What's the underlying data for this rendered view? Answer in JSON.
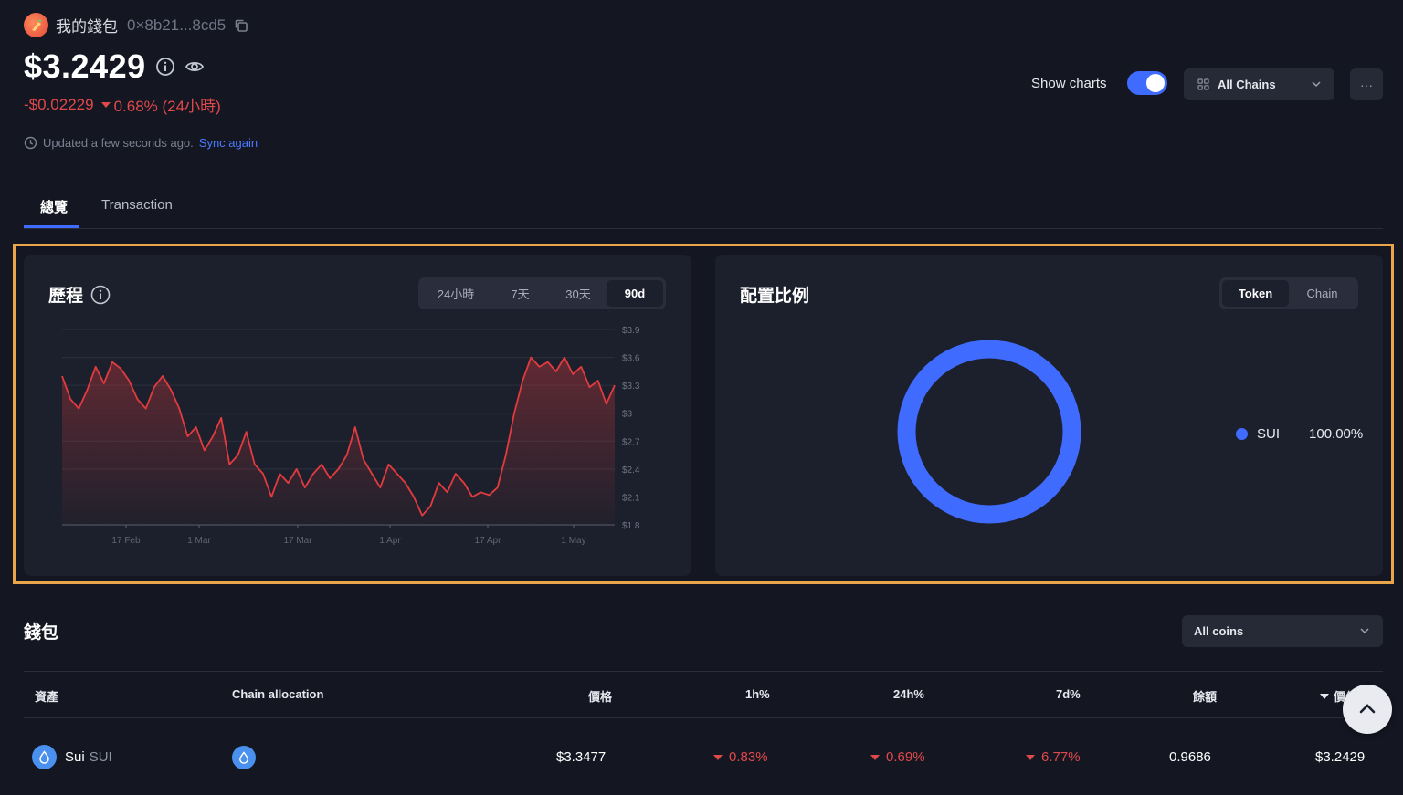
{
  "header": {
    "wallet_name": "我的錢包",
    "wallet_address": "0×8b21...8cd5",
    "balance": "$3.2429",
    "change_amount": "-$0.02229",
    "change_percent": "0.68% (24小時)",
    "updated_text": "Updated a few seconds ago.",
    "sync_label": "Sync again",
    "show_charts_label": "Show charts",
    "show_charts_on": true,
    "chains_label": "All Chains",
    "more_label": "···"
  },
  "tabs": [
    {
      "label": "總覽",
      "active": true
    },
    {
      "label": "Transaction",
      "active": false
    }
  ],
  "history": {
    "title": "歷程",
    "ranges": [
      "24小時",
      "7天",
      "30天",
      "90d"
    ],
    "active_range": "90d"
  },
  "allocation": {
    "title": "配置比例",
    "modes": [
      "Token",
      "Chain"
    ],
    "active_mode": "Token",
    "legend": [
      {
        "name": "SUI",
        "percent": "100.00%",
        "color": "#3f6bff"
      }
    ]
  },
  "chart_data": {
    "type": "line",
    "title": "",
    "xlabel": "",
    "ylabel": "",
    "x_ticks": [
      "17 Feb",
      "1 Mar",
      "17 Mar",
      "1 Apr",
      "17 Apr",
      "1 May"
    ],
    "y_ticks": [
      "$3.9",
      "$3.6",
      "$3.3",
      "$3",
      "$2.7",
      "$2.4",
      "$2.1",
      "$1.8"
    ],
    "ylim": [
      1.8,
      3.9
    ],
    "grid": true,
    "line_color": "#e23b3f",
    "series": [
      {
        "values": [
          3.4,
          3.15,
          3.05,
          3.25,
          3.5,
          3.32,
          3.55,
          3.48,
          3.35,
          3.15,
          3.05,
          3.28,
          3.4,
          3.25,
          3.05,
          2.75,
          2.85,
          2.6,
          2.75,
          2.95,
          2.45,
          2.55,
          2.8,
          2.45,
          2.35,
          2.1,
          2.35,
          2.25,
          2.4,
          2.2,
          2.35,
          2.45,
          2.3,
          2.4,
          2.55,
          2.85,
          2.5,
          2.35,
          2.2,
          2.45,
          2.35,
          2.25,
          2.1,
          1.9,
          2.0,
          2.25,
          2.15,
          2.35,
          2.25,
          2.1,
          2.15,
          2.12,
          2.2,
          2.55,
          3.0,
          3.35,
          3.6,
          3.5,
          3.55,
          3.45,
          3.6,
          3.42,
          3.5,
          3.28,
          3.35,
          3.1,
          3.3
        ]
      }
    ]
  },
  "wallet": {
    "title": "錢包",
    "filter_label": "All coins",
    "columns": [
      "資產",
      "Chain allocation",
      "價格",
      "1h%",
      "24h%",
      "7d%",
      "餘額",
      "價值"
    ],
    "rows": [
      {
        "asset": "Sui",
        "symbol": "SUI",
        "price": "$3.3477",
        "h1": "0.83%",
        "h24": "0.69%",
        "d7": "6.77%",
        "balance": "0.9686",
        "value": "$3.2429"
      }
    ]
  }
}
